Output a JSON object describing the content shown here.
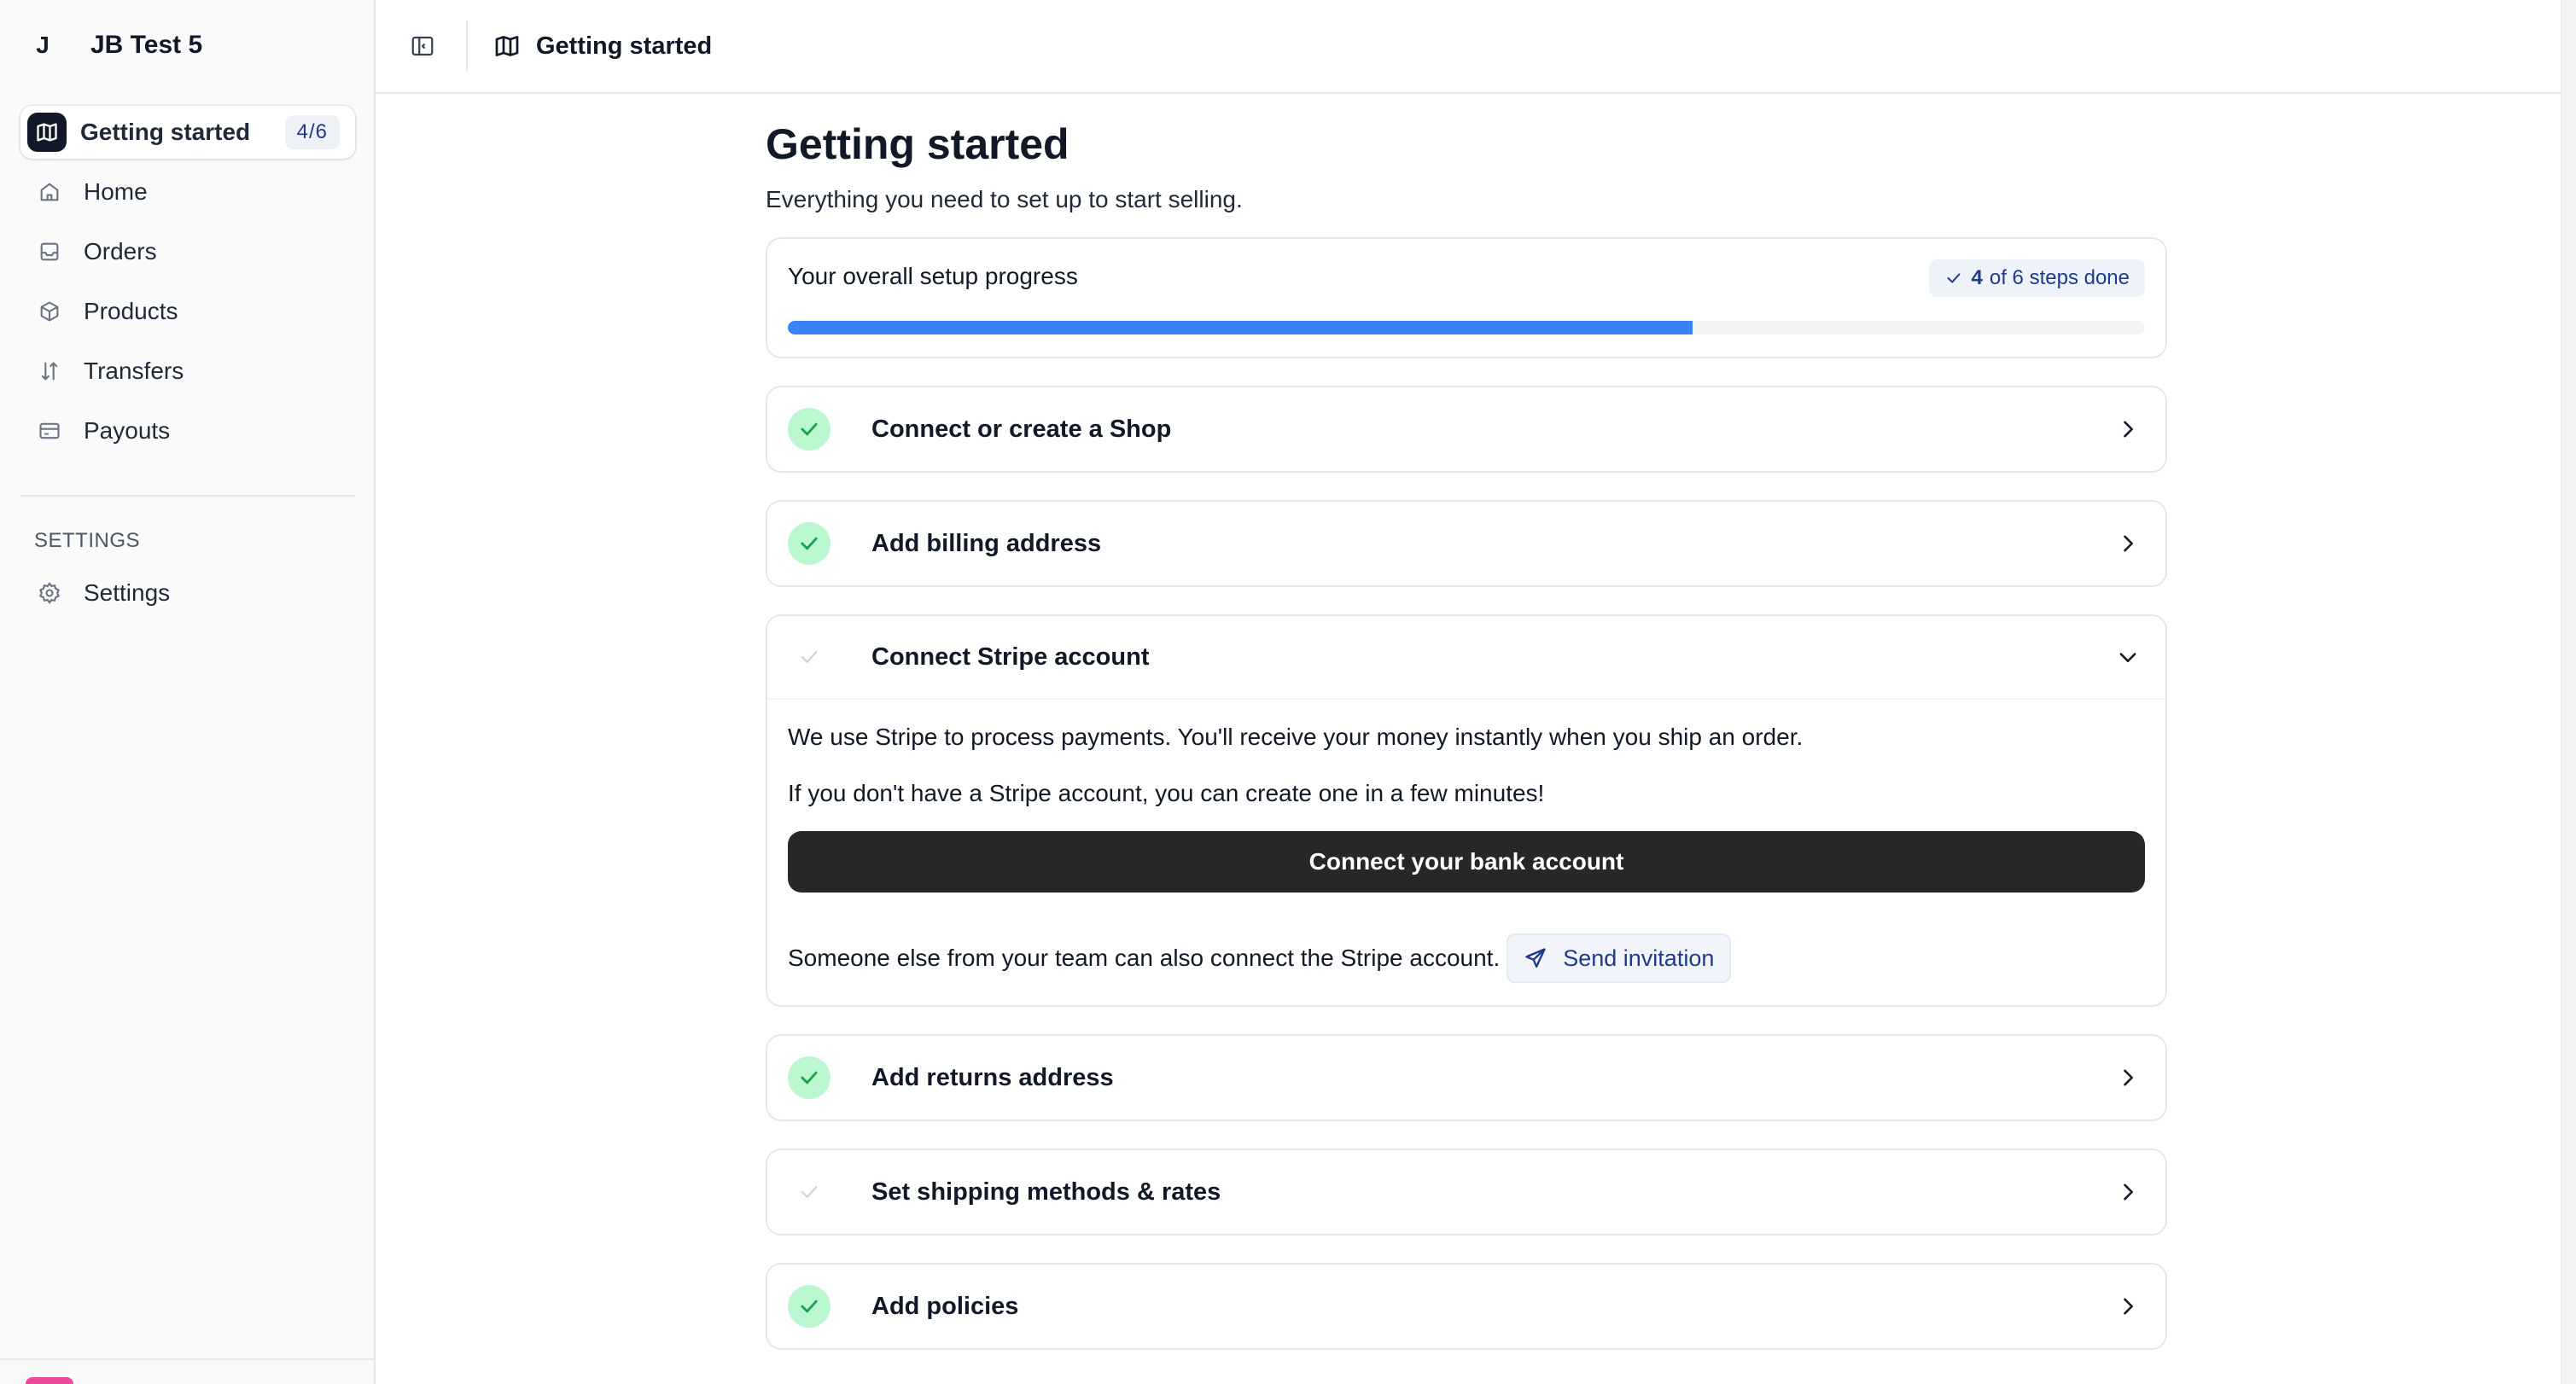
{
  "workspace": {
    "initial": "J",
    "name": "JB Test 5"
  },
  "sidebar": {
    "items": [
      {
        "label": "Getting started",
        "icon": "map-icon",
        "badge": "4/6"
      },
      {
        "label": "Home",
        "icon": "home-icon"
      },
      {
        "label": "Orders",
        "icon": "inbox-icon"
      },
      {
        "label": "Products",
        "icon": "box-icon"
      },
      {
        "label": "Transfers",
        "icon": "arrows-vertical-icon"
      },
      {
        "label": "Payouts",
        "icon": "credit-card-icon"
      }
    ],
    "settings_section": "SETTINGS",
    "settings_item": {
      "label": "Settings",
      "icon": "gear-icon"
    }
  },
  "topbar": {
    "title": "Getting started"
  },
  "main": {
    "title": "Getting started",
    "subtitle": "Everything you need to set up to start selling.",
    "progress": {
      "label": "Your overall setup progress",
      "done": "4",
      "rest": "of 6 steps done",
      "completed": 4,
      "total": 6
    },
    "steps": [
      {
        "title": "Connect or create a Shop",
        "done": true
      },
      {
        "title": "Add billing address",
        "done": true
      },
      {
        "title": "Connect Stripe account",
        "done": false,
        "expanded": true
      },
      {
        "title": "Add returns address",
        "done": true
      },
      {
        "title": "Set shipping methods & rates",
        "done": false
      },
      {
        "title": "Add policies",
        "done": true
      }
    ],
    "stripe": {
      "text1": "We use Stripe to process payments. You'll receive your money instantly when you ship an order.",
      "text2": "If you don't have a Stripe account, you can create one in a few minutes!",
      "button": "Connect your bank account",
      "invite_text": "Someone else from your team can also connect the Stripe account.",
      "invite_button": "Send invitation"
    }
  },
  "colors": {
    "accent": "#3b82f6",
    "check_bg": "#bbf7d0",
    "check": "#16a34a",
    "primary_button": "#27272a"
  }
}
